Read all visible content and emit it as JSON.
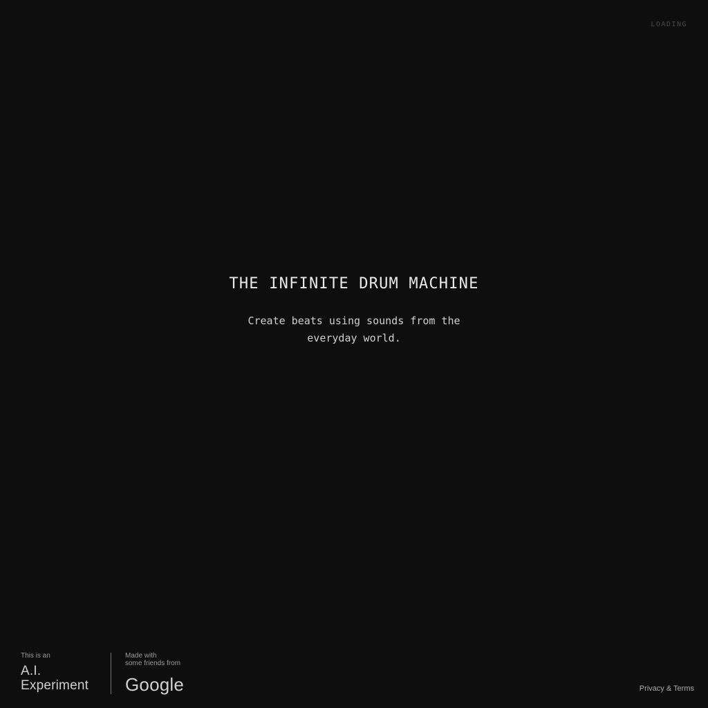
{
  "status": {
    "loading_label": "LOADING"
  },
  "hero": {
    "title": "THE INFINITE DRUM MACHINE",
    "subtitle": "Create beats using sounds from the everyday world."
  },
  "footer": {
    "ai_experiment": {
      "prefix": "This is an",
      "line1": "A.I.",
      "line2": "Experiment"
    },
    "made_with": {
      "line1": "Made with",
      "line2": "some friends from",
      "brand": "Google"
    },
    "privacy_terms": "Privacy & Terms"
  }
}
